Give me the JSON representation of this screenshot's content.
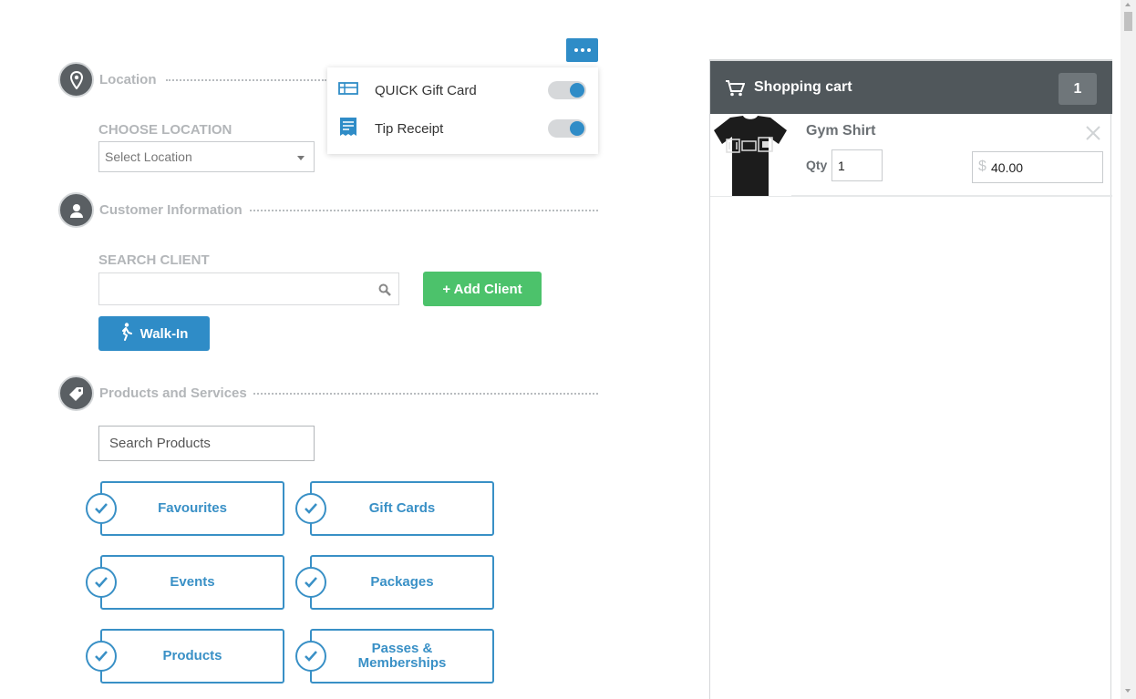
{
  "sections": {
    "location": {
      "title": "Location",
      "icon": "map-pin-icon"
    },
    "customer": {
      "title": "Customer Information",
      "icon": "user-icon"
    },
    "products": {
      "title": "Products and Services",
      "icon": "tag-icon"
    }
  },
  "location": {
    "field_label": "CHOOSE LOCATION",
    "select_value": "Select Location"
  },
  "client": {
    "field_label": "SEARCH CLIENT",
    "search_value": "",
    "add_label": "+ Add Client",
    "walkin_label": "Walk-In"
  },
  "products": {
    "search_placeholder": "Search Products",
    "categories": [
      {
        "label": "Favourites"
      },
      {
        "label": "Gift Cards"
      },
      {
        "label": "Events"
      },
      {
        "label": "Packages"
      },
      {
        "label": "Products"
      },
      {
        "label": "Passes & Memberships"
      }
    ]
  },
  "menu": {
    "items": [
      {
        "label": "QUICK Gift Card",
        "icon": "gift-card-icon",
        "enabled": true
      },
      {
        "label": "Tip Receipt",
        "icon": "receipt-icon",
        "enabled": true
      }
    ]
  },
  "cart": {
    "title": "Shopping cart",
    "count": "1",
    "items": [
      {
        "name": "Gym Shirt",
        "qty_label": "Qty",
        "qty": "1",
        "currency": "$",
        "price": "40.00"
      }
    ]
  },
  "colors": {
    "accent": "#2f8cc7",
    "add_button": "#4cc26b",
    "cart_header": "#50575b",
    "section_icon": "#5a5f63"
  }
}
